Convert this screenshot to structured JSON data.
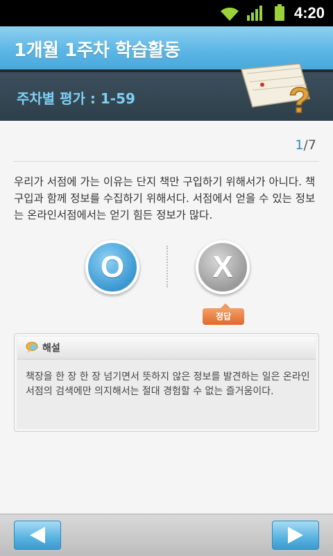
{
  "status_bar": {
    "time": "4:20",
    "icons": [
      "wifi-icon",
      "signal-icon",
      "battery-icon"
    ]
  },
  "title_bar": {
    "title": "1개월 1주차 학습활동"
  },
  "sub_header": {
    "subtitle": "주차별 평가 : 1-59",
    "decoration": "notebook-question-icon"
  },
  "quiz": {
    "page_current": "1",
    "page_total": "/7",
    "question": "우리가 서점에 가는 이유는 단지 책만 구입하기 위해서가 아니다. 책 구입과 함께 정보를 수집하기 위해서다. 서점에서 얻을 수 있는 정보는 온라인서점에서는 얻기 힘든 정보가 많다.",
    "option_o": "O",
    "option_x": "X",
    "answer_badge": "정답"
  },
  "explanation": {
    "title": "해설",
    "body": "책장을 한 장 한 장 넘기면서 뜻하지 않은 정보를 발견하는 일은 온라인 서점의 검색에만 의지해서는 절대 경험할 수 없는 즐거움이다."
  },
  "bottom_nav": {
    "prev_icon": "arrow-left-icon",
    "next_icon": "arrow-right-icon"
  },
  "colors": {
    "title_bar": "#5db7e6",
    "sub_header": "#2e3f4a",
    "accent": "#2a8ac5",
    "answer_badge": "#e06a2b"
  }
}
